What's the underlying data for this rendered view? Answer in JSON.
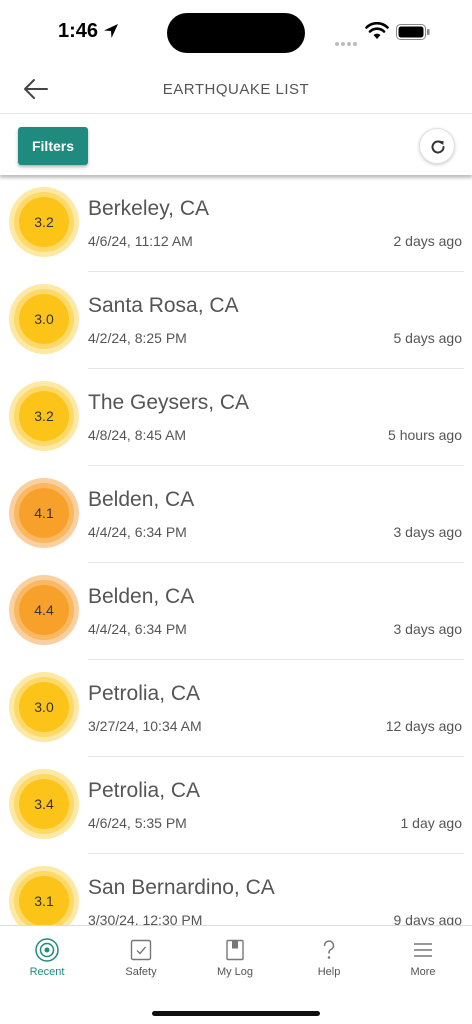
{
  "status_bar": {
    "time": "1:46"
  },
  "header": {
    "title": "EARTHQUAKE LIST"
  },
  "toolbar": {
    "filters_label": "Filters"
  },
  "colors": {
    "accent": "#1f8b7f",
    "mag_low": "#fcc419",
    "mag_mid": "#f8a12a"
  },
  "quakes": [
    {
      "mag": "3.2",
      "place": "Berkeley, CA",
      "datetime": "4/6/24, 11:12 AM",
      "ago": "2 days ago",
      "level": "low"
    },
    {
      "mag": "3.0",
      "place": "Santa Rosa, CA",
      "datetime": "4/2/24, 8:25 PM",
      "ago": "5 days ago",
      "level": "low"
    },
    {
      "mag": "3.2",
      "place": "The Geysers, CA",
      "datetime": "4/8/24, 8:45 AM",
      "ago": "5 hours ago",
      "level": "low"
    },
    {
      "mag": "4.1",
      "place": "Belden, CA",
      "datetime": "4/4/24, 6:34 PM",
      "ago": "3 days ago",
      "level": "mid"
    },
    {
      "mag": "4.4",
      "place": "Belden, CA",
      "datetime": "4/4/24, 6:34 PM",
      "ago": "3 days ago",
      "level": "mid"
    },
    {
      "mag": "3.0",
      "place": "Petrolia, CA",
      "datetime": "3/27/24, 10:34 AM",
      "ago": "12 days ago",
      "level": "low"
    },
    {
      "mag": "3.4",
      "place": "Petrolia, CA",
      "datetime": "4/6/24, 5:35 PM",
      "ago": "1 day ago",
      "level": "low"
    },
    {
      "mag": "3.1",
      "place": "San Bernardino, CA",
      "datetime": "3/30/24, 12:30 PM",
      "ago": "9 days ago",
      "level": "low"
    }
  ],
  "tabs": [
    {
      "label": "Recent",
      "icon": "recent-icon",
      "active": true
    },
    {
      "label": "Safety",
      "icon": "safety-checkbox-icon",
      "active": false
    },
    {
      "label": "My Log",
      "icon": "book-icon",
      "active": false
    },
    {
      "label": "Help",
      "icon": "question-icon",
      "active": false
    },
    {
      "label": "More",
      "icon": "menu-icon",
      "active": false
    }
  ]
}
